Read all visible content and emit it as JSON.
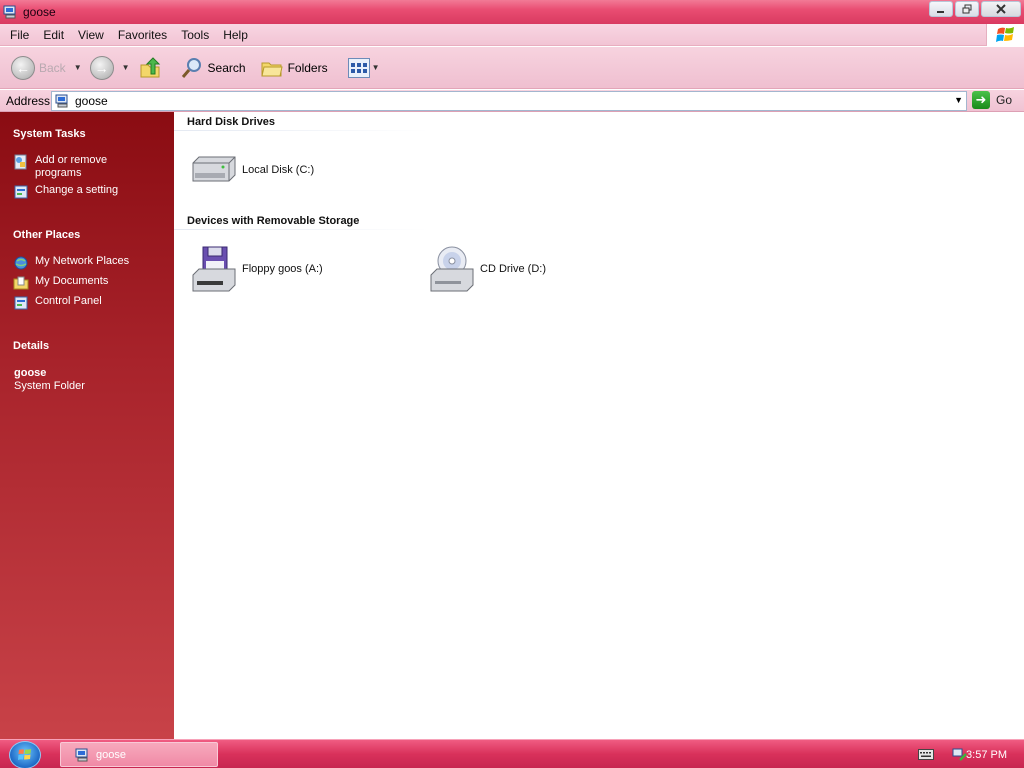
{
  "window": {
    "title": "goose",
    "icon": "my-computer-icon"
  },
  "menu": [
    "File",
    "Edit",
    "View",
    "Favorites",
    "Tools",
    "Help"
  ],
  "toolbar": {
    "back_label": "Back",
    "search_label": "Search",
    "folders_label": "Folders"
  },
  "address": {
    "label": "Address",
    "value": "goose",
    "go_label": "Go"
  },
  "taskpane": {
    "system_tasks": {
      "title": "System Tasks",
      "items": [
        {
          "label": "Add or remove programs",
          "icon": "add-remove-programs-icon"
        },
        {
          "label": "Change a setting",
          "icon": "control-panel-icon"
        }
      ]
    },
    "other_places": {
      "title": "Other Places",
      "items": [
        {
          "label": "My Network Places",
          "icon": "network-places-icon"
        },
        {
          "label": "My Documents",
          "icon": "my-documents-icon"
        },
        {
          "label": "Control Panel",
          "icon": "control-panel-icon"
        }
      ]
    },
    "details": {
      "title": "Details",
      "name": "goose",
      "type": "System Folder"
    }
  },
  "content": {
    "groups": [
      {
        "title": "Hard Disk Drives",
        "items": [
          {
            "label": "Local Disk (C:)",
            "icon": "hard-drive-icon"
          }
        ]
      },
      {
        "title": "Devices with Removable Storage",
        "items": [
          {
            "label": "Floppy goos (A:)",
            "icon": "floppy-drive-icon"
          },
          {
            "label": "CD Drive (D:)",
            "icon": "cd-drive-icon"
          }
        ]
      }
    ]
  },
  "taskbar": {
    "task_label": "goose",
    "clock": "3:57 PM"
  },
  "colors": {
    "accent": "#e94d72",
    "taskpane": "#a8232b",
    "toolbar": "#f2c4d4"
  }
}
